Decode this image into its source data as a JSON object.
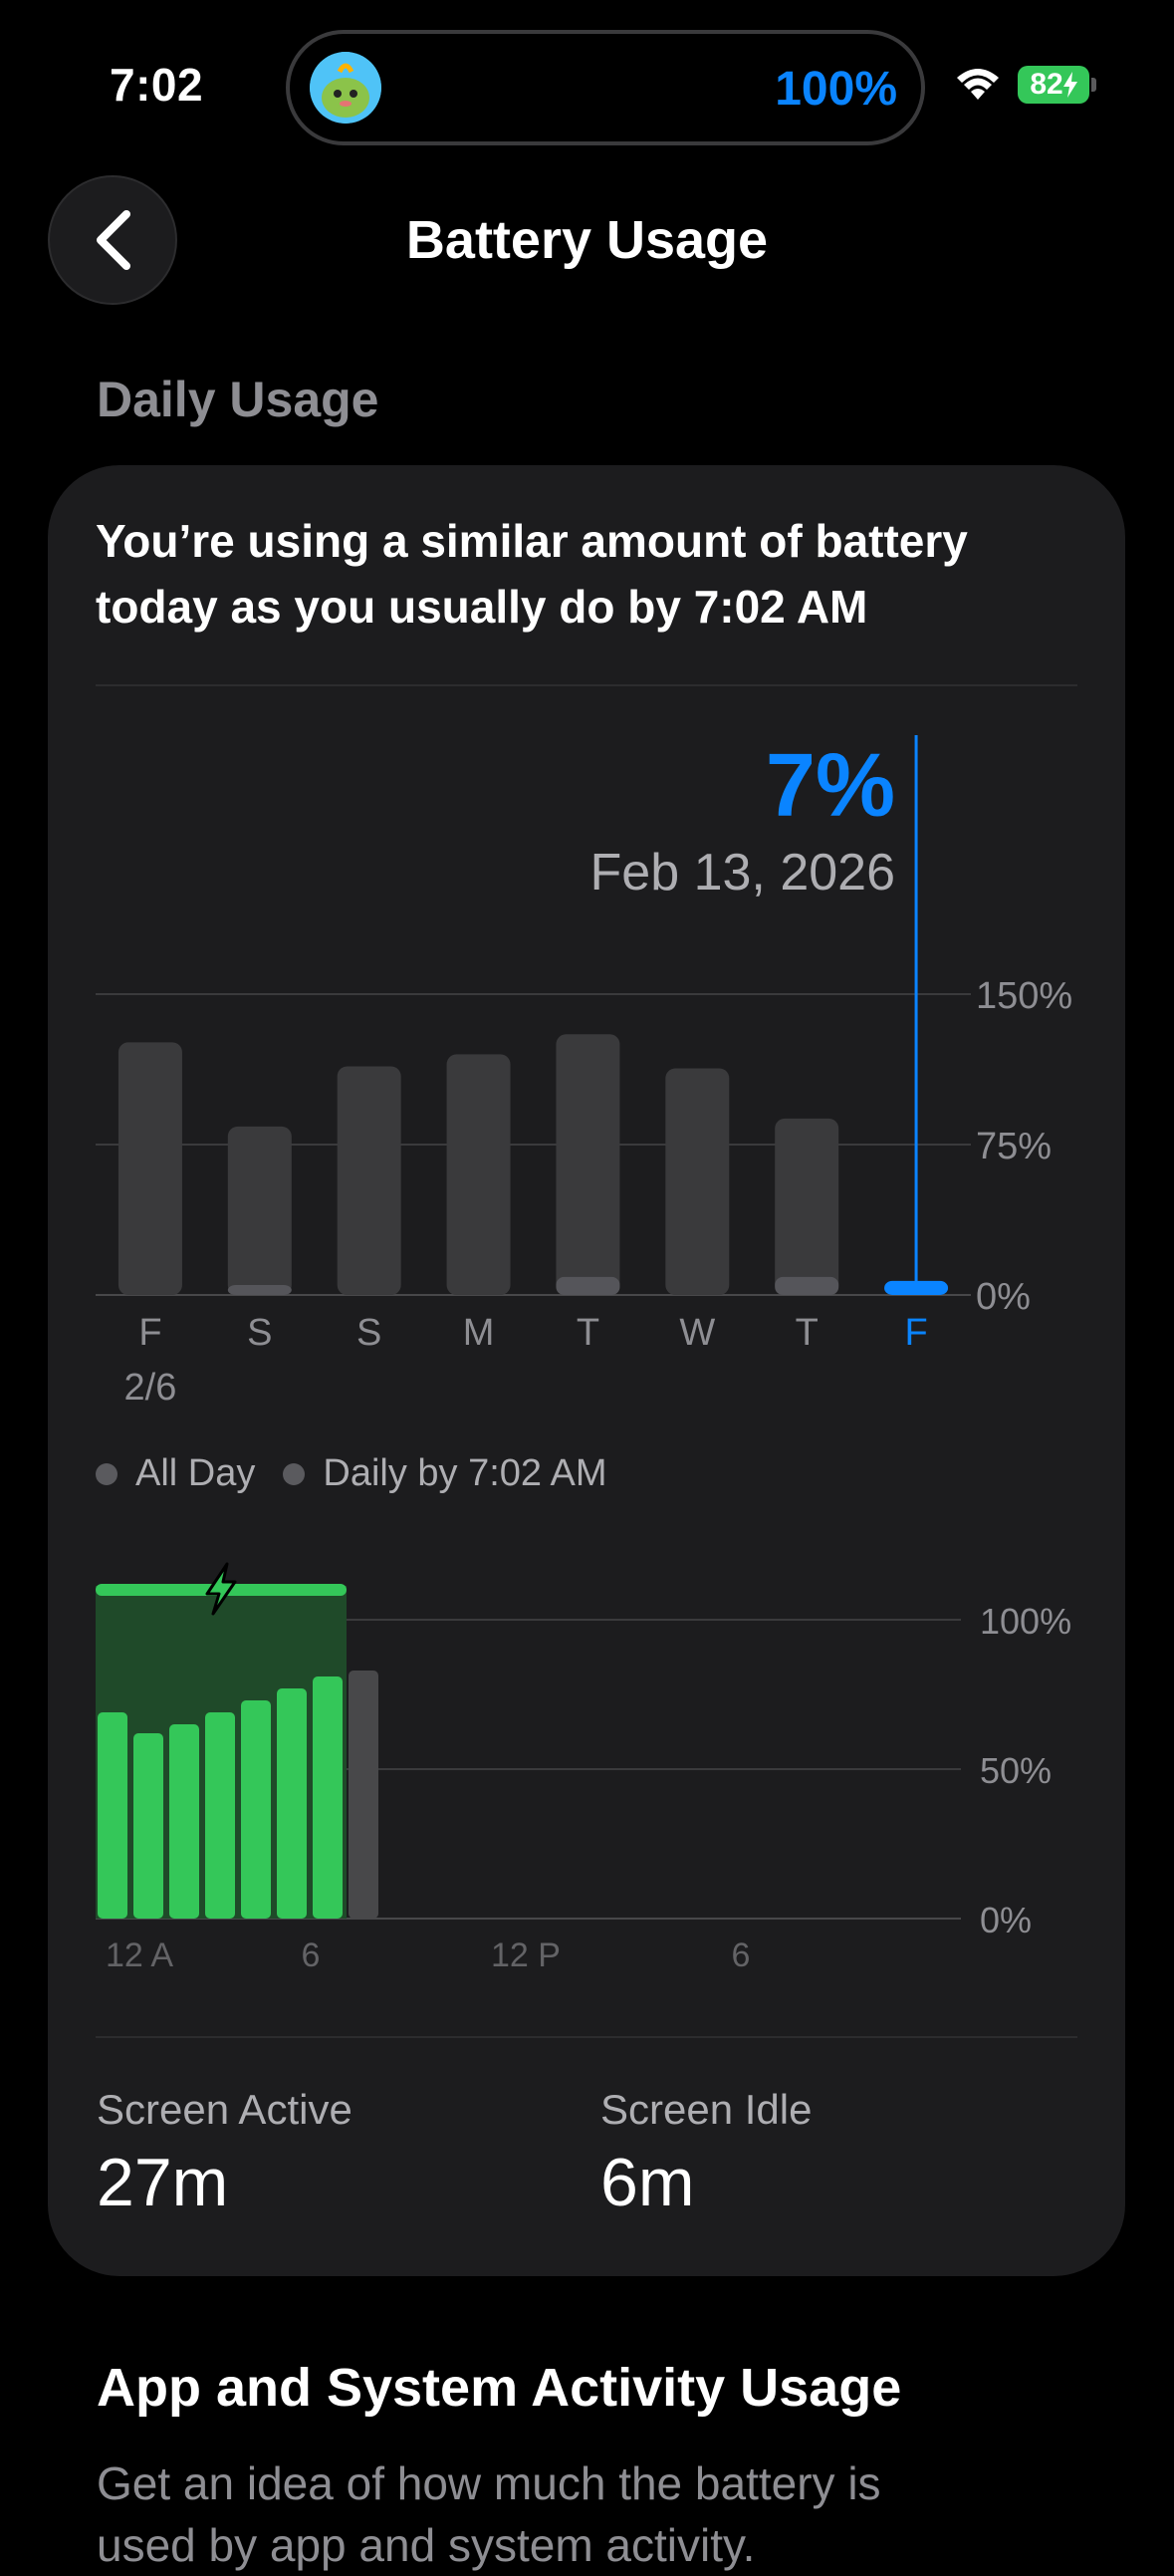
{
  "status_bar": {
    "time": "7:02",
    "activity_percent": "100%",
    "battery_level": "82"
  },
  "nav": {
    "title": "Battery Usage"
  },
  "daily_usage": {
    "header": "Daily Usage",
    "summary_line1": "You’re using a similar amount of battery",
    "summary_line2": "today as you usually do by 7:02 AM",
    "selected_value": "7%",
    "selected_date": "Feb 13, 2026",
    "legend": [
      "All Day",
      "Daily by 7:02 AM"
    ],
    "screen_active_label": "Screen Active",
    "screen_active_value": "27m",
    "screen_idle_label": "Screen Idle",
    "screen_idle_value": "6m"
  },
  "colors": {
    "accent": "#0a84ff",
    "charge_green": "#34c759",
    "bar_gray": "#3a3a3c"
  },
  "chart_data": [
    {
      "type": "bar",
      "categories": [
        "F",
        "S",
        "S",
        "M",
        "T",
        "W",
        "T",
        "F"
      ],
      "first_category_date": "2/6",
      "selected_index": 7,
      "series": [
        {
          "name": "All Day",
          "values": [
            126,
            84,
            114,
            120,
            130,
            113,
            88,
            null
          ]
        },
        {
          "name": "Daily by 7:02 AM",
          "values": [
            0,
            1,
            0,
            0,
            9,
            0,
            9,
            7
          ]
        }
      ],
      "yticks": [
        "150%",
        "75%",
        "0%"
      ],
      "ylim": [
        0,
        150
      ],
      "grid": true
    },
    {
      "type": "bar",
      "categories": [
        "12 A",
        "6",
        "12 P",
        "6"
      ],
      "x": [
        0,
        1,
        2,
        3,
        4,
        5,
        6,
        7
      ],
      "values": [
        69,
        62,
        65,
        69,
        73,
        77,
        81,
        83
      ],
      "charging_from_hour": 0,
      "charging_to_hour": 7,
      "yticks": [
        "100%",
        "50%",
        "0%"
      ],
      "ylim": [
        0,
        100
      ],
      "grid": true
    }
  ],
  "app_activity": {
    "title": "App and System Activity Usage",
    "description_line1": "Get an idea of how much the battery is",
    "description_line2": "used by app and system activity."
  }
}
